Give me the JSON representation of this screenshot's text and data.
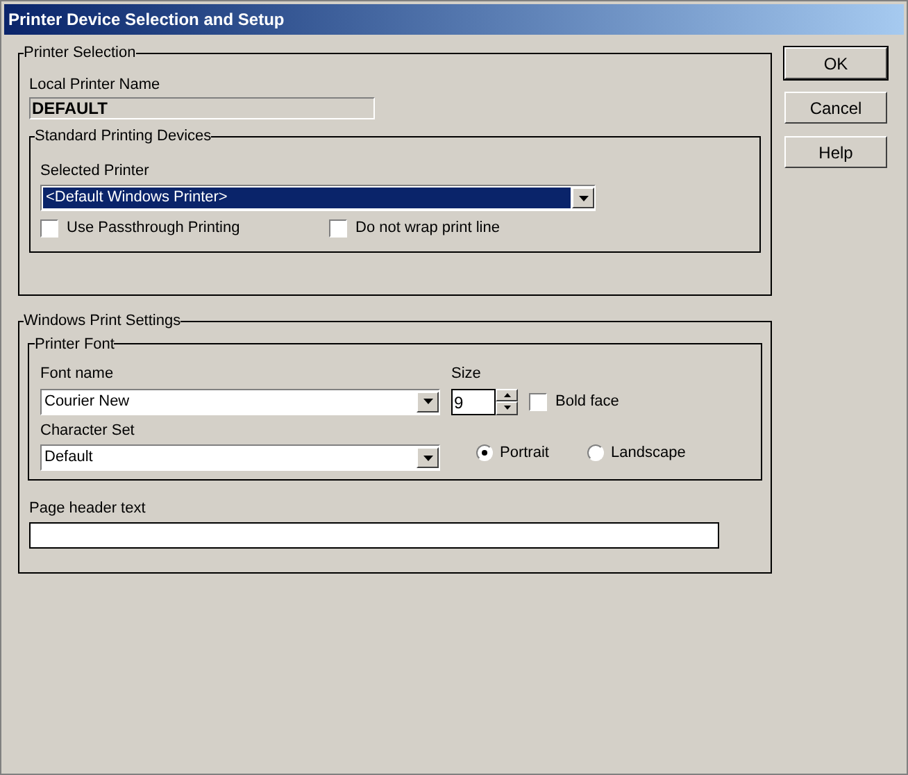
{
  "window": {
    "title": "Printer Device Selection and Setup"
  },
  "printer_selection": {
    "title": "Printer Selection",
    "local_printer_name": {
      "label": "Local Printer Name",
      "value": "DEFAULT"
    },
    "standard_printing_devices": {
      "title": "Standard Printing Devices",
      "selected_printer": {
        "label": "Selected Printer",
        "value": "<Default Windows Printer>",
        "highlighted": true
      },
      "options": [
        {
          "label": "Use Passthrough Printing",
          "checked": false
        },
        {
          "label": "Do not wrap print line",
          "checked": false
        }
      ]
    }
  },
  "windows_print_settings": {
    "title": "Windows Print Settings",
    "printer_font": {
      "title": "Printer Font",
      "font_name": {
        "label": "Font name",
        "value": "Courier New"
      },
      "size": {
        "label": "Size",
        "value": "9"
      },
      "bold_face": {
        "label": "Bold face",
        "checked": false
      },
      "character_set": {
        "label": "Character Set",
        "value": "Default"
      },
      "orientation": [
        {
          "label": "Portrait",
          "selected": true
        },
        {
          "label": "Landscape",
          "selected": false
        }
      ]
    },
    "page_header_text": {
      "label": "Page header text"
    }
  },
  "buttons": [
    {
      "label": "OK",
      "default": true
    },
    {
      "label": "Cancel",
      "default": false
    },
    {
      "label": "Help",
      "default": false
    }
  ]
}
